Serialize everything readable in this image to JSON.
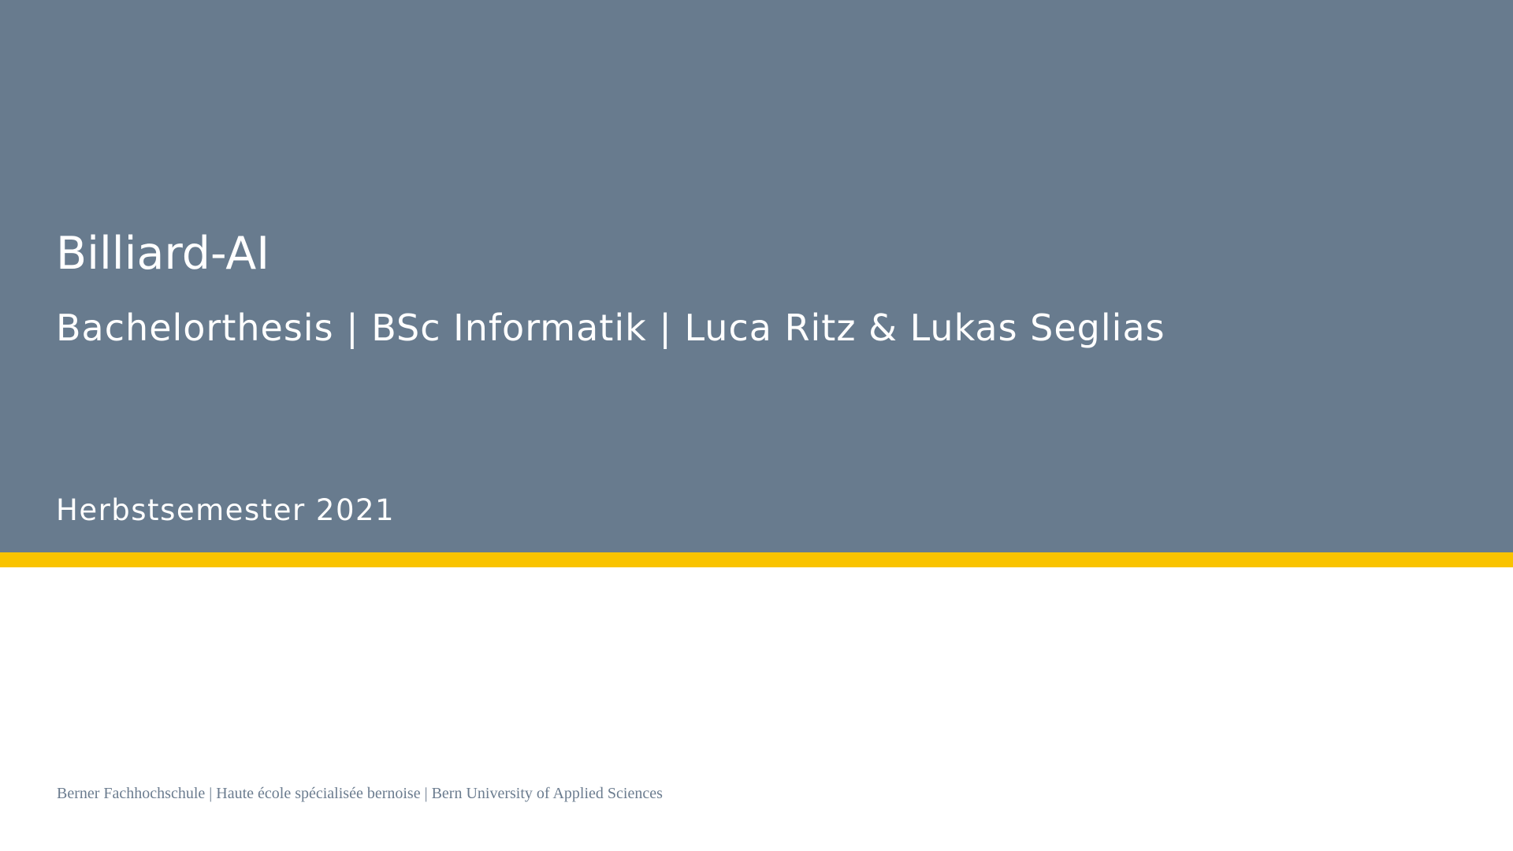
{
  "slide": {
    "title": "Billiard-AI",
    "subtitle": "Bachelorthesis | BSc Informatik | Luca Ritz & Lukas Seglias",
    "semester": "Herbstsemester 2021",
    "footer": "Berner Fachhochschule | Haute école spécialisée bernoise | Bern University of Applied Sciences"
  },
  "colors": {
    "hero_background": "#687b8e",
    "accent_bar": "#f9c300",
    "slide_background": "#ffffff",
    "title_text": "#ffffff",
    "footer_text": "#6b7c8f"
  }
}
